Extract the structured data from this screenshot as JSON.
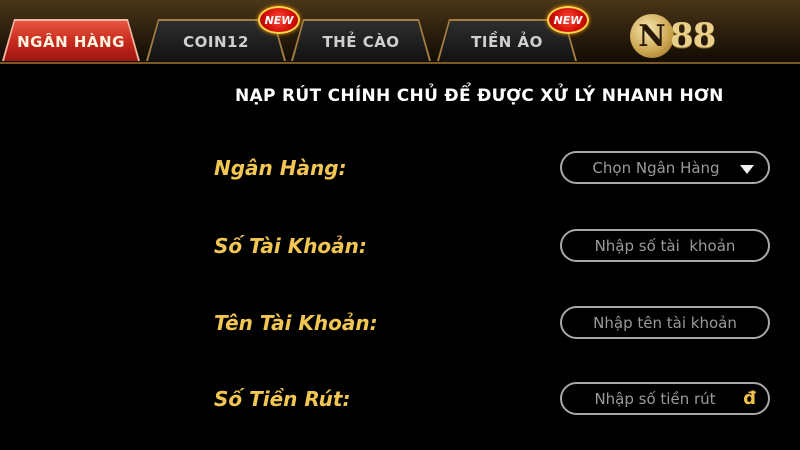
{
  "tabs": [
    {
      "label": "NGÂN HÀNG",
      "active": true
    },
    {
      "label": "COIN12",
      "badge": "NEW"
    },
    {
      "label": "THẺ CÀO"
    },
    {
      "label": "TIỀN ẢO",
      "badge": "NEW"
    }
  ],
  "logo": {
    "letter": "N",
    "number": "88"
  },
  "heading": "NẠP RÚT CHÍNH CHỦ ĐỂ ĐƯỢC XỬ LÝ NHANH HƠN",
  "form": {
    "bank": {
      "label": "Ngân Hàng:",
      "value": "Chọn Ngân Hàng"
    },
    "account_number": {
      "label": "Số Tài Khoản:",
      "placeholder": "Nhập số tài  khoản"
    },
    "account_name": {
      "label": "Tên Tài Khoản:",
      "placeholder": "Nhập tên tài khoản"
    },
    "amount": {
      "label": "Số Tiền Rút:",
      "placeholder": "Nhập số tiền rút",
      "currency": "đ"
    }
  },
  "colors": {
    "active_tab": "#c5281c",
    "label_gold": "#f1c653",
    "background": "#000000"
  }
}
